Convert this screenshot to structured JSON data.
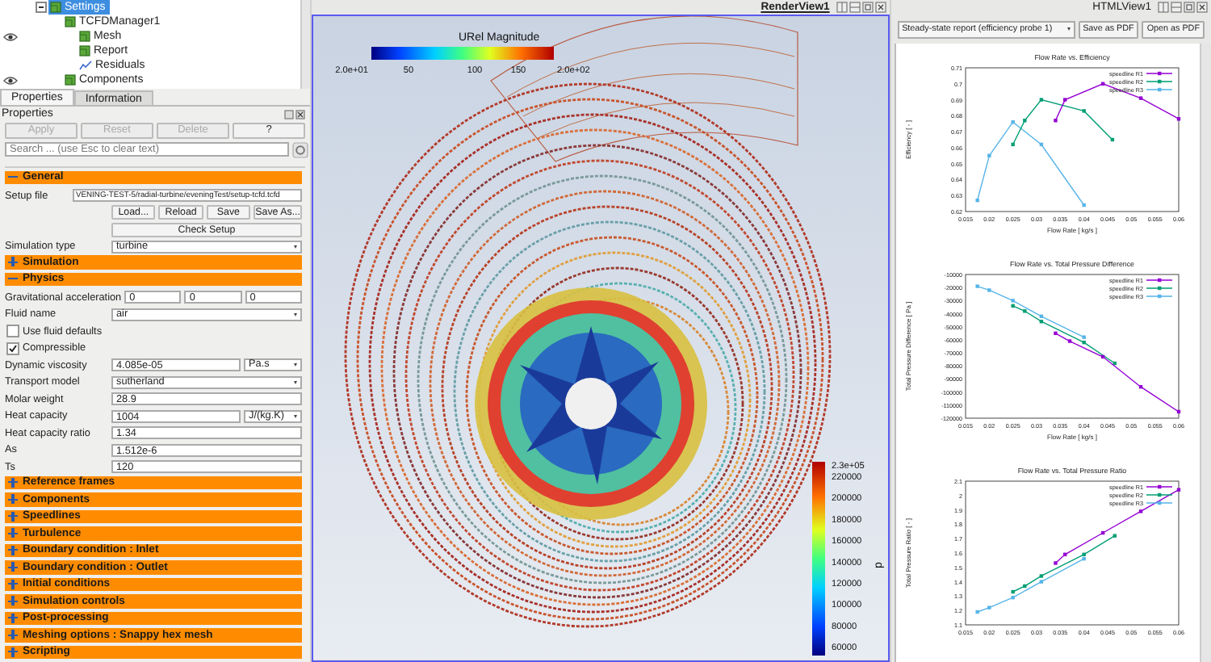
{
  "pipeline_browser": {
    "items": [
      {
        "label": "Settings",
        "kind": "cube",
        "selected": true,
        "visible": false,
        "expanded": true,
        "children": [
          {
            "label": "TCFDManager1",
            "kind": "cube",
            "selected": false,
            "visible": false,
            "children": [
              {
                "label": "Mesh",
                "kind": "cube",
                "selected": false,
                "visible": true
              },
              {
                "label": "Report",
                "kind": "cube",
                "selected": false,
                "visible": false
              },
              {
                "label": "Residuals",
                "kind": "chart",
                "selected": false,
                "visible": false
              }
            ]
          },
          {
            "label": "Components",
            "kind": "cube",
            "selected": false,
            "visible": true
          }
        ]
      }
    ]
  },
  "properties_panel": {
    "tabs": [
      {
        "label": "Properties",
        "selected": true
      },
      {
        "label": "Information",
        "selected": false
      }
    ],
    "title": "Properties",
    "buttons": [
      {
        "label": "Apply",
        "disabled": true
      },
      {
        "label": "Reset",
        "disabled": true
      },
      {
        "label": "Delete",
        "disabled": true
      },
      {
        "label": "?",
        "disabled": false
      }
    ],
    "search": {
      "placeholder": "Search ... (use Esc to clear text)"
    },
    "sections": [
      {
        "title": "General",
        "expanded": true,
        "rows": [
          {
            "kind": "text",
            "label": "Setup file",
            "value": "VENING-TEST-5/radial-turbine/eveningTest/setup-tcfd.tcfd"
          },
          {
            "kind": "buttons",
            "buttons": [
              "Load...",
              "Reload",
              "Save",
              "Save As..."
            ]
          },
          {
            "kind": "button",
            "label": "Check Setup"
          },
          {
            "kind": "select",
            "label": "Simulation type",
            "value": "turbine"
          }
        ]
      },
      {
        "title": "Simulation",
        "expanded": false
      },
      {
        "title": "Physics",
        "expanded": true,
        "rows": [
          {
            "kind": "vector",
            "label": "Gravitational acceleration",
            "values": [
              "0",
              "0",
              "0"
            ]
          },
          {
            "kind": "select",
            "label": "Fluid name",
            "value": "air"
          },
          {
            "kind": "checkbox",
            "label": "Use fluid defaults",
            "checked": false
          },
          {
            "kind": "checkbox",
            "label": "Compressible",
            "checked": true
          },
          {
            "kind": "unit",
            "label": "Dynamic viscosity",
            "value": "4.085e-05",
            "unit": "Pa.s"
          },
          {
            "kind": "select",
            "label": "Transport model",
            "value": "sutherland"
          },
          {
            "kind": "text",
            "label": "Molar weight",
            "value": "28.9"
          },
          {
            "kind": "unit",
            "label": "Heat capacity",
            "value": "1004",
            "unit": "J/(kg.K)"
          },
          {
            "kind": "text",
            "label": "Heat capacity ratio",
            "value": "1.34"
          },
          {
            "kind": "text",
            "label": "As",
            "value": "1.512e-6"
          },
          {
            "kind": "text",
            "label": "Ts",
            "value": "120"
          }
        ]
      },
      {
        "title": "Reference frames",
        "expanded": false
      },
      {
        "title": "Components",
        "expanded": false
      },
      {
        "title": "Speedlines",
        "expanded": false
      },
      {
        "title": "Turbulence",
        "expanded": false
      },
      {
        "title": "Boundary condition : Inlet",
        "expanded": false
      },
      {
        "title": "Boundary condition : Outlet",
        "expanded": false
      },
      {
        "title": "Initial conditions",
        "expanded": false
      },
      {
        "title": "Simulation controls",
        "expanded": false
      },
      {
        "title": "Post-processing",
        "expanded": false
      },
      {
        "title": "Meshing options : Snappy hex mesh",
        "expanded": false
      },
      {
        "title": "Scripting",
        "expanded": false
      }
    ]
  },
  "render_view": {
    "title": "RenderView1",
    "velocity_legend": {
      "title": "URel Magnitude",
      "labels": [
        "2.0e+01",
        "50",
        "100",
        "150",
        "2.0e+02"
      ]
    },
    "pressure_legend": {
      "title": "p",
      "labels": [
        "2.3e+05",
        "220000",
        "200000",
        "180000",
        "160000",
        "140000",
        "120000",
        "100000",
        "80000",
        "60000"
      ]
    }
  },
  "html_view": {
    "title": "HTMLView1",
    "report_select": {
      "value": "Steady-state report (efficiency probe 1)"
    },
    "buttons": [
      "Save as PDF",
      "Open as PDF"
    ],
    "charts": [
      {
        "chart_data": {
          "type": "line",
          "title": "Flow Rate vs. Efficiency",
          "xlabel": "Flow Rate [ kg/s ]",
          "ylabel": "Efficiency [ - ]",
          "xlim": [
            0.015,
            0.06
          ],
          "ylim": [
            0.62,
            0.71
          ],
          "legend": true,
          "xticks": [
            0.015,
            0.02,
            0.025,
            0.03,
            0.035,
            0.04,
            0.045,
            0.05,
            0.055,
            0.06
          ],
          "yticks": [
            0.62,
            0.63,
            0.64,
            0.65,
            0.66,
            0.67,
            0.68,
            0.69,
            0.7,
            0.71
          ],
          "series": [
            {
              "name": "speedline R1",
              "color": "#9400d3",
              "marker": "square",
              "x": [
                0.034,
                0.036,
                0.044,
                0.052,
                0.06
              ],
              "values": [
                0.677,
                0.69,
                0.7,
                0.691,
                0.678
              ]
            },
            {
              "name": "speedline R2",
              "color": "#009e73",
              "marker": "square",
              "x": [
                0.025,
                0.0275,
                0.031,
                0.04,
                0.046
              ],
              "values": [
                0.662,
                0.677,
                0.69,
                0.683,
                0.665
              ]
            },
            {
              "name": "speedline R3",
              "color": "#56b4e9",
              "marker": "square",
              "x": [
                0.0175,
                0.02,
                0.025,
                0.031,
                0.04
              ],
              "values": [
                0.627,
                0.655,
                0.676,
                0.662,
                0.624
              ]
            }
          ]
        }
      },
      {
        "chart_data": {
          "type": "line",
          "title": "Flow Rate vs. Total Pressure Difference",
          "xlabel": "Flow Rate [ kg/s ]",
          "ylabel": "Total Pressure Difference [ Pa ]",
          "xlim": [
            0.015,
            0.06
          ],
          "ylim": [
            -120000,
            -10000
          ],
          "legend": true,
          "xticks": [
            0.015,
            0.02,
            0.025,
            0.03,
            0.035,
            0.04,
            0.045,
            0.05,
            0.055,
            0.06
          ],
          "yticks": [
            -120000,
            -110000,
            -100000,
            -90000,
            -80000,
            -70000,
            -60000,
            -50000,
            -40000,
            -30000,
            -20000,
            -10000
          ],
          "series": [
            {
              "name": "speedline R1",
              "color": "#9400d3",
              "marker": "square",
              "x": [
                0.034,
                0.037,
                0.044,
                0.052,
                0.06
              ],
              "values": [
                -55000,
                -61000,
                -73000,
                -96000,
                -115000
              ]
            },
            {
              "name": "speedline R2",
              "color": "#009e73",
              "marker": "square",
              "x": [
                0.025,
                0.0275,
                0.031,
                0.04,
                0.0465
              ],
              "values": [
                -34000,
                -38000,
                -46000,
                -62000,
                -78000
              ]
            },
            {
              "name": "speedline R3",
              "color": "#56b4e9",
              "marker": "square",
              "x": [
                0.0175,
                0.02,
                0.025,
                0.031,
                0.04
              ],
              "values": [
                -19000,
                -22000,
                -30000,
                -42000,
                -58000
              ]
            }
          ]
        }
      },
      {
        "chart_data": {
          "type": "line",
          "title": "Flow Rate vs. Total Pressure Ratio",
          "ylabel": "Total Pressure Ratio [ - ]",
          "xlim": [
            0.015,
            0.06
          ],
          "ylim": [
            1.1,
            2.1
          ],
          "legend": true,
          "xticks": [
            0.015,
            0.02,
            0.025,
            0.03,
            0.035,
            0.04,
            0.045,
            0.05,
            0.055,
            0.06
          ],
          "yticks": [
            1.1,
            1.2,
            1.3,
            1.4,
            1.5,
            1.6,
            1.7,
            1.8,
            1.9,
            2,
            2.1
          ],
          "series": [
            {
              "name": "speedline R1",
              "color": "#9400d3",
              "marker": "square",
              "x": [
                0.034,
                0.036,
                0.044,
                0.052,
                0.06
              ],
              "values": [
                1.53,
                1.59,
                1.74,
                1.89,
                2.04
              ]
            },
            {
              "name": "speedline R2",
              "color": "#009e73",
              "marker": "square",
              "x": [
                0.025,
                0.0275,
                0.031,
                0.04,
                0.0465
              ],
              "values": [
                1.33,
                1.37,
                1.44,
                1.59,
                1.72
              ]
            },
            {
              "name": "speedline R3",
              "color": "#56b4e9",
              "marker": "square",
              "x": [
                0.0175,
                0.02,
                0.025,
                0.031,
                0.04
              ],
              "values": [
                1.19,
                1.22,
                1.29,
                1.4,
                1.56
              ]
            }
          ]
        }
      }
    ]
  }
}
